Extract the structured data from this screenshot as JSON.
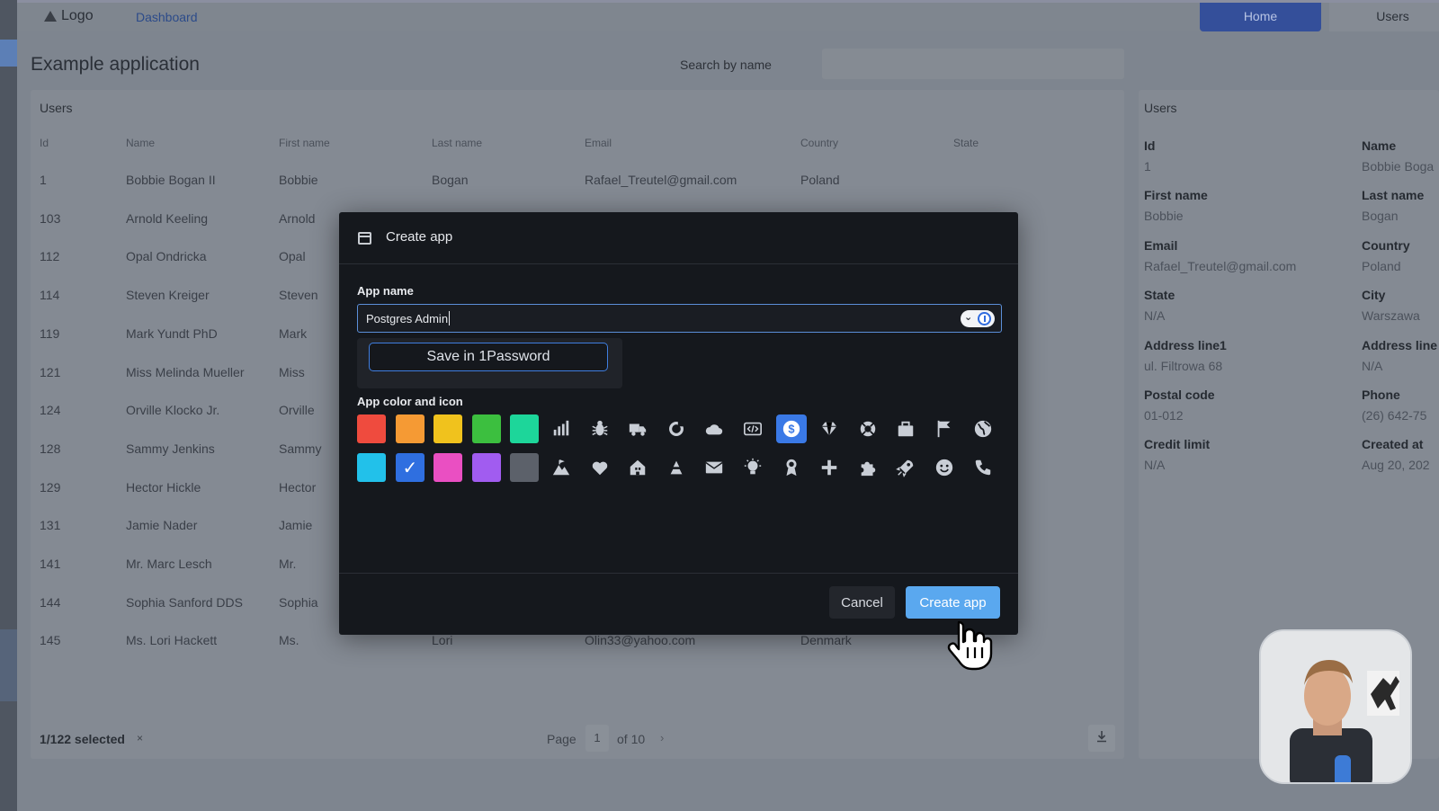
{
  "topbar": {
    "logo": "Logo",
    "dashboard": "Dashboard",
    "home": "Home",
    "users": "Users"
  },
  "page": {
    "title": "Example application",
    "search_label": "Search by name"
  },
  "table": {
    "title": "Users",
    "columns": [
      "Id",
      "Name",
      "First name",
      "Last name",
      "Email",
      "Country",
      "State"
    ],
    "rows": [
      [
        "1",
        "Bobbie Bogan II",
        "Bobbie",
        "Bogan",
        "Rafael_Treutel@gmail.com",
        "Poland",
        ""
      ],
      [
        "103",
        "Arnold Keeling",
        "Arnold",
        "",
        "",
        "",
        ""
      ],
      [
        "112",
        "Opal Ondricka",
        "Opal",
        "",
        "",
        "",
        ""
      ],
      [
        "114",
        "Steven Kreiger",
        "Steven",
        "",
        "",
        "",
        ""
      ],
      [
        "119",
        "Mark Yundt PhD",
        "Mark",
        "",
        "",
        "",
        ""
      ],
      [
        "121",
        "Miss Melinda Mueller",
        "Miss",
        "",
        "",
        "",
        ""
      ],
      [
        "124",
        "Orville Klocko Jr.",
        "Orville",
        "",
        "",
        "",
        ""
      ],
      [
        "128",
        "Sammy Jenkins",
        "Sammy",
        "",
        "",
        "",
        ""
      ],
      [
        "129",
        "Hector Hickle",
        "Hector",
        "",
        "",
        "",
        ""
      ],
      [
        "131",
        "Jamie Nader",
        "Jamie",
        "",
        "",
        "",
        ""
      ],
      [
        "141",
        "Mr. Marc Lesch",
        "Mr.",
        "",
        "",
        "",
        ""
      ],
      [
        "144",
        "Sophia Sanford DDS",
        "Sophia",
        "",
        "",
        "",
        ""
      ],
      [
        "145",
        "Ms. Lori Hackett",
        "Ms.",
        "Lori",
        "Olin33@yahoo.com",
        "Denmark",
        ""
      ]
    ],
    "selected": "1/122 selected",
    "clear": "×",
    "page_label": "Page",
    "page_number": "1",
    "page_of": "of 10",
    "next": "›"
  },
  "detail": {
    "title": "Users",
    "fields": [
      {
        "label": "Id",
        "value": "1"
      },
      {
        "label": "Name",
        "value": "Bobbie Boga"
      },
      {
        "label": "First name",
        "value": "Bobbie"
      },
      {
        "label": "Last name",
        "value": "Bogan"
      },
      {
        "label": "Email",
        "value": "Rafael_Treutel@gmail.com"
      },
      {
        "label": "Country",
        "value": "Poland"
      },
      {
        "label": "State",
        "value": "N/A"
      },
      {
        "label": "City",
        "value": "Warszawa"
      },
      {
        "label": "Address line1",
        "value": "ul. Filtrowa 68"
      },
      {
        "label": "Address line",
        "value": "N/A"
      },
      {
        "label": "Postal code",
        "value": "01-012"
      },
      {
        "label": "Phone",
        "value": "(26) 642-75"
      },
      {
        "label": "Credit limit",
        "value": "N/A"
      },
      {
        "label": "Created at",
        "value": "Aug 20, 202"
      }
    ]
  },
  "modal": {
    "title": "Create app",
    "app_name_label": "App name",
    "app_name_value": "Postgres Admin",
    "save_1password": "Save in 1Password",
    "color_icon_label": "App color and icon",
    "colors_row1": [
      "#ef4b3e",
      "#f59a34",
      "#f0c21d",
      "#3cbf3f",
      "#1dd69a"
    ],
    "colors_row2": [
      "#22c1ea",
      "#2f6fe0",
      "#ea4fc2",
      "#a15cf0",
      "#5c616a"
    ],
    "selected_color": "#2f6fe0",
    "icons_row1": [
      "bar-chart-icon",
      "bug-icon",
      "truck-icon",
      "refresh-icon",
      "cloud-icon",
      "code-icon",
      "dollar-icon",
      "diamond-icon",
      "lifebuoy-icon",
      "briefcase-icon",
      "flag-icon",
      "globe-icon"
    ],
    "icons_row2": [
      "mountain-icon",
      "heart-icon",
      "house-icon",
      "recycle-icon",
      "mail-icon",
      "lightbulb-icon",
      "badge-icon",
      "plus-icon",
      "puzzle-icon",
      "rocket-icon",
      "smiley-icon",
      "phone-icon"
    ],
    "selected_icon": "dollar-icon",
    "cancel": "Cancel",
    "create": "Create app"
  }
}
